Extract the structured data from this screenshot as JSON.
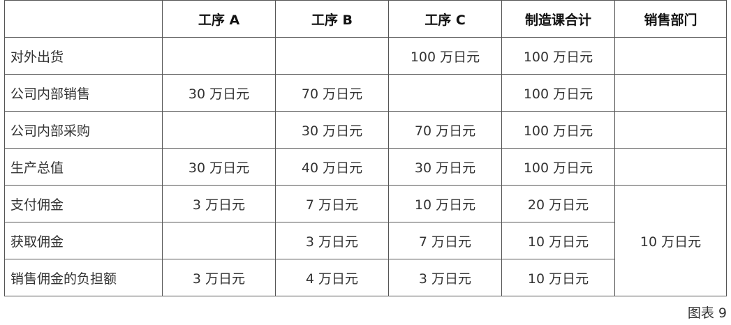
{
  "table": {
    "headers": [
      "",
      "工序 A",
      "工序 B",
      "工序 C",
      "制造课合计",
      "销售部门"
    ],
    "rows": [
      {
        "label": "对外出货",
        "cells": [
          "",
          "",
          "100 万日元",
          "100 万日元"
        ]
      },
      {
        "label": "公司内部销售",
        "cells": [
          "30 万日元",
          "70 万日元",
          "",
          "100 万日元"
        ]
      },
      {
        "label": "公司内部采购",
        "cells": [
          "",
          "30 万日元",
          "70 万日元",
          "100 万日元"
        ]
      },
      {
        "label": "生产总值",
        "cells": [
          "30 万日元",
          "40 万日元",
          "30 万日元",
          "100 万日元"
        ]
      },
      {
        "label": "支付佣金",
        "cells": [
          "3 万日元",
          "7 万日元",
          "10 万日元",
          "20 万日元"
        ]
      },
      {
        "label": "获取佣金",
        "cells": [
          "",
          "3 万日元",
          "7 万日元",
          "10 万日元"
        ]
      },
      {
        "label": "销售佣金的负担额",
        "cells": [
          "3 万日元",
          "4 万日元",
          "3 万日元",
          "10 万日元"
        ]
      }
    ],
    "sales_merged_value": "10 万日元"
  },
  "caption": "图表 9"
}
